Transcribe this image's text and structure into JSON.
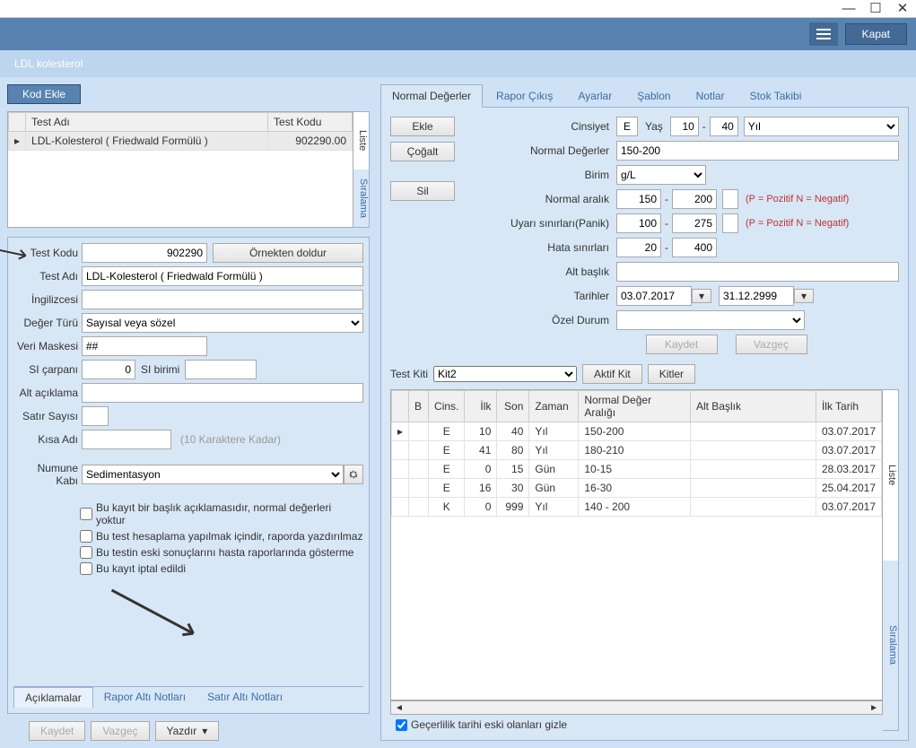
{
  "window": {
    "minimize": "—",
    "maximize": "☐",
    "close": "✕"
  },
  "header": {
    "close_label": "Kapat"
  },
  "title": "LDL kolesterol",
  "btn_kod_ekle": "Kod Ekle",
  "test_grid": {
    "cols": {
      "name": "Test Adı",
      "code": "Test Kodu"
    },
    "rows": [
      {
        "name": "LDL-Kolesterol ( Friedwald Formülü )",
        "code": "902290.00"
      }
    ]
  },
  "vtabs": {
    "liste": "Liste",
    "siralama": "Sıralama"
  },
  "form": {
    "labels": {
      "test_kodu": "Test Kodu",
      "test_adi": "Test Adı",
      "ingilizcesi": "İngilizcesi",
      "deger_turu": "Değer Türü",
      "veri_maskesi": "Veri Maskesi",
      "si_carpani": "SI çarpanı",
      "si_birimi": "SI birimi",
      "alt_aciklama": "Alt açıklama",
      "satir_sayisi": "Satır Sayısı",
      "kisa_adi": "Kısa Adı",
      "numune_kabi": "Numune Kabı"
    },
    "values": {
      "test_kodu": "902290",
      "ornekten": "Örnekten doldur",
      "test_adi": "LDL-Kolesterol ( Friedwald Formülü )",
      "ingilizcesi": "",
      "deger_turu": "Sayısal veya sözel",
      "veri_maskesi": "##",
      "si_carpani": "0",
      "si_birimi": "",
      "alt_aciklama": "",
      "satir_sayisi": "",
      "kisa_adi": "",
      "kisa_adi_hint": "(10 Karaktere Kadar)",
      "numune_kabi": "Sedimentasyon"
    },
    "checks": {
      "c1": "Bu kayıt bir başlık açıklamasıdır, normal değerleri yoktur",
      "c2": "Bu test hesaplama yapılmak içindir, raporda yazdırılmaz",
      "c3": "Bu testin eski sonuçlarını hasta raporlarında gösterme",
      "c4": "Bu kayıt iptal edildi"
    }
  },
  "bottom_tabs": {
    "t1": "Açıklamalar",
    "t2": "Rapor Altı Notları",
    "t3": "Satır Altı Notları"
  },
  "actions": {
    "kaydet": "Kaydet",
    "vazgec": "Vazgeç",
    "yazdir": "Yazdır"
  },
  "right": {
    "tabs": {
      "t1": "Normal Değerler",
      "t2": "Rapor Çıkış",
      "t3": "Ayarlar",
      "t4": "Şablon",
      "t5": "Notlar",
      "t6": "Stok Takibi"
    },
    "action_btns": {
      "ekle": "Ekle",
      "cogalt": "Çoğalt",
      "sil": "Sil"
    },
    "labels": {
      "cinsiyet": "Cinsiyet",
      "yas": "Yaş",
      "normal_degerler": "Normal Değerler",
      "birim": "Birim",
      "normal_aralik": "Normal aralık",
      "uyari": "Uyarı sınırları(Panik)",
      "hata": "Hata sınırları",
      "alt_baslik": "Alt başlık",
      "tarihler": "Tarihler",
      "ozel_durum": "Özel Durum",
      "kaydet": "Kaydet",
      "vazgec": "Vazgeç",
      "test_kiti": "Test Kiti",
      "aktif_kit": "Aktif Kit",
      "kitler": "Kitler"
    },
    "values": {
      "cinsiyet": "E",
      "yas1": "10",
      "yas2": "40",
      "yas_unit": "Yıl",
      "normal_degerler": "150-200",
      "birim": "g/L",
      "normal_aralik1": "150",
      "normal_aralik2": "200",
      "uyari1": "100",
      "uyari2": "275",
      "hata1": "20",
      "hata2": "400",
      "alt_baslik": "",
      "tarih1": "03.07.2017",
      "tarih2": "31.12.2999",
      "ozel_durum": "",
      "test_kiti": "Kit2"
    },
    "pn_note": "(P = Pozitif   N = Negatif)",
    "kit_grid": {
      "cols": {
        "b": "B",
        "cins": "Cins.",
        "ilk": "İlk",
        "son": "Son",
        "zaman": "Zaman",
        "aralik": "Normal Değer Aralığı",
        "alt_baslik": "Alt Başlık",
        "ilk_tarih": "İlk Tarih"
      },
      "rows": [
        {
          "cins": "E",
          "ilk": "10",
          "son": "40",
          "zaman": "Yıl",
          "aralik": "150-200",
          "alt": "",
          "tarih": "03.07.2017"
        },
        {
          "cins": "E",
          "ilk": "41",
          "son": "80",
          "zaman": "Yıl",
          "aralik": "180-210",
          "alt": "",
          "tarih": "03.07.2017"
        },
        {
          "cins": "E",
          "ilk": "0",
          "son": "15",
          "zaman": "Gün",
          "aralik": "10-15",
          "alt": "",
          "tarih": "28.03.2017"
        },
        {
          "cins": "E",
          "ilk": "16",
          "son": "30",
          "zaman": "Gün",
          "aralik": "16-30",
          "alt": "",
          "tarih": "25.04.2017"
        },
        {
          "cins": "K",
          "ilk": "0",
          "son": "999",
          "zaman": "Yıl",
          "aralik": "140 - 200",
          "alt": "",
          "tarih": "03.07.2017"
        }
      ]
    },
    "footer_check": "Geçerlilik tarihi eski olanları gizle"
  }
}
